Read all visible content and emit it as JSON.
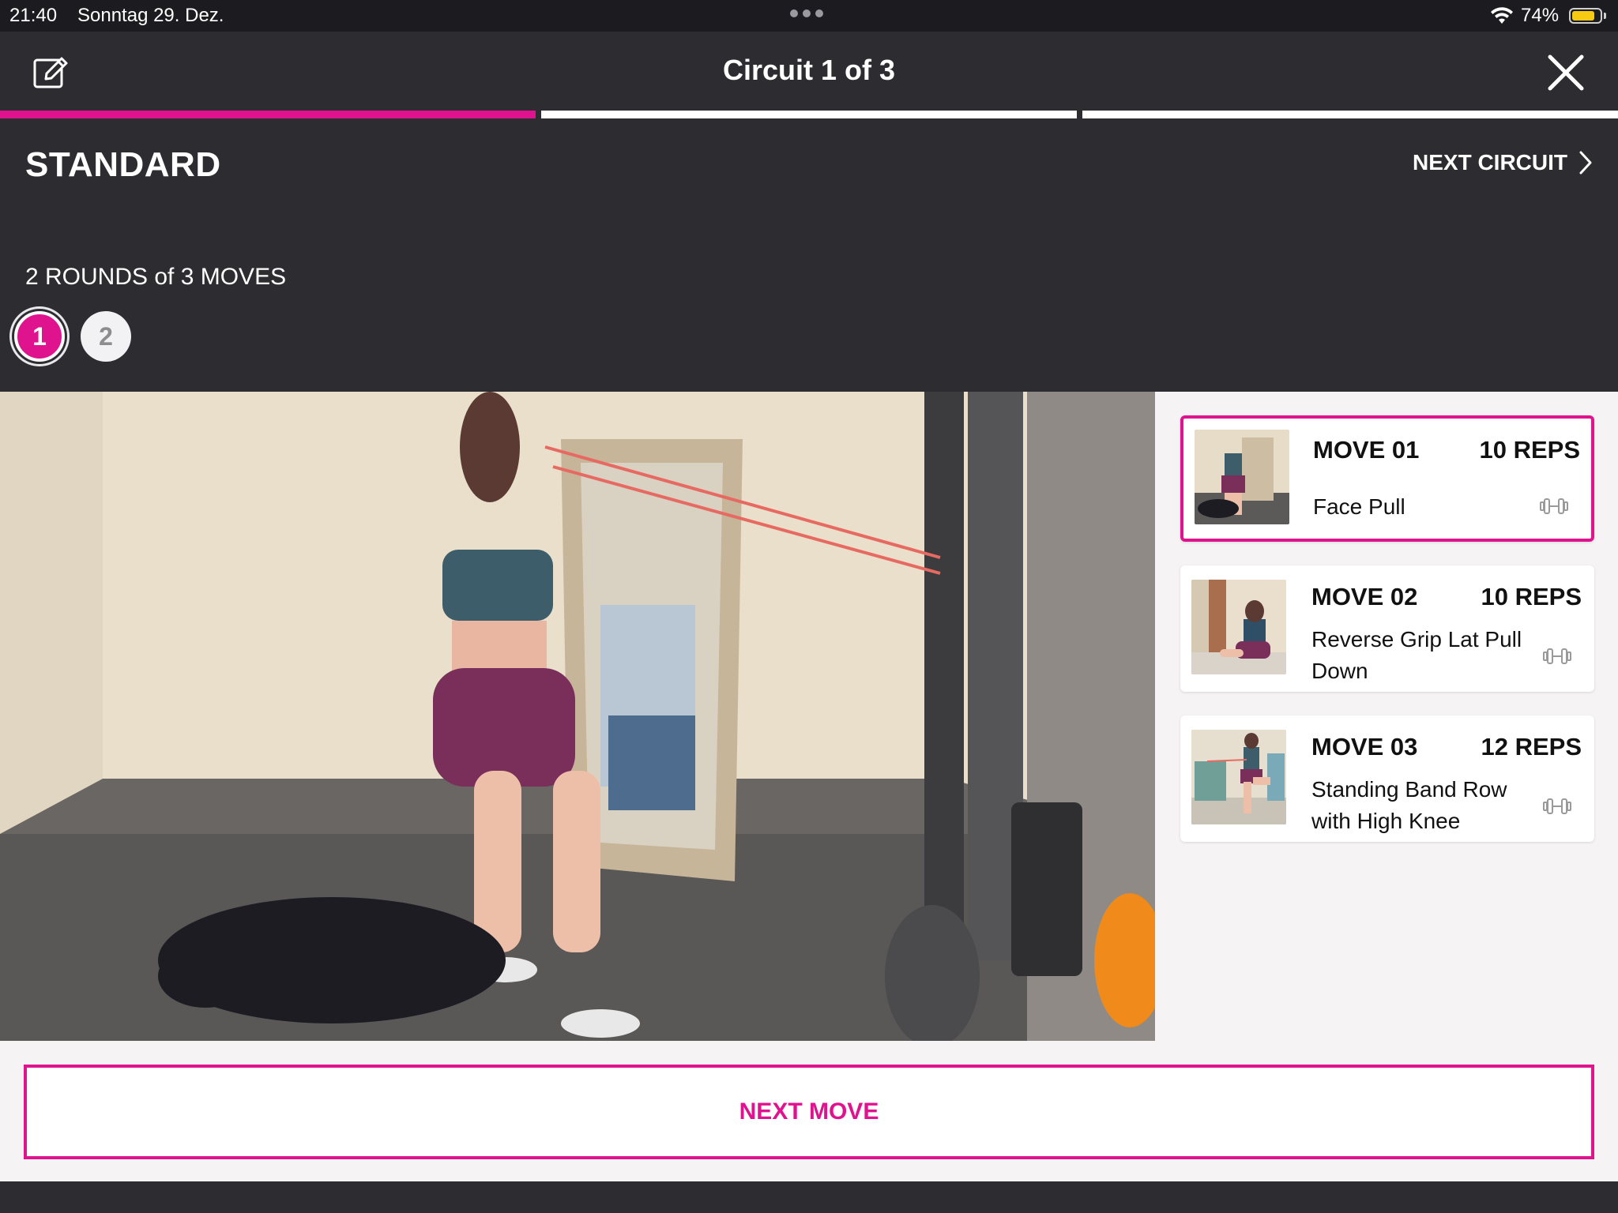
{
  "status_bar": {
    "time": "21:40",
    "date": "Sonntag 29. Dez.",
    "battery": "74%"
  },
  "header": {
    "title": "Circuit 1 of 3"
  },
  "progress": {
    "total_circuits": 3,
    "current_circuit": 1
  },
  "circuit": {
    "name": "STANDARD",
    "next_label": "NEXT CIRCUIT",
    "rounds_text": "2 ROUNDS of 3 MOVES",
    "rounds": [
      "1",
      "2"
    ],
    "active_round": "1"
  },
  "moves": [
    {
      "number": "MOVE 01",
      "reps": "10 REPS",
      "name": "Face Pull"
    },
    {
      "number": "MOVE 02",
      "reps": "10 REPS",
      "name": "Reverse Grip Lat Pull Down"
    },
    {
      "number": "MOVE 03",
      "reps": "12 REPS",
      "name": "Standing Band Row with High Knee"
    }
  ],
  "next_move_label": "NEXT MOVE",
  "colors": {
    "accent": "#e0138e",
    "header_bg": "#2d2c31",
    "content_bg": "#f5f3f4"
  }
}
